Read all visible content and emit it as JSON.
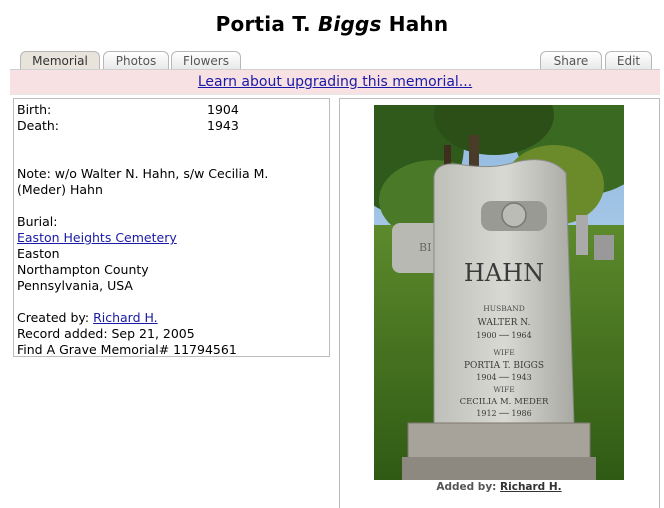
{
  "title": {
    "first": "Portia T. ",
    "maiden": "Biggs",
    "last": " Hahn"
  },
  "tabs": {
    "memorial": "Memorial",
    "photos": "Photos",
    "flowers": "Flowers",
    "share": "Share",
    "edit": "Edit"
  },
  "upgrade_link": "Learn about upgrading this memorial...",
  "info": {
    "birth_label": "Birth:",
    "birth_value": "1904",
    "death_label": "Death:",
    "death_value": "1943",
    "note_line1": "Note: w/o Walter N. Hahn, s/w Cecilia M.",
    "note_line2": "(Meder) Hahn",
    "burial_label": "Burial:",
    "cemetery": "Easton Heights Cemetery",
    "city": "Easton",
    "county": "Northampton County",
    "state": "Pennsylvania, USA",
    "created_by_label": "Created by: ",
    "created_by": "Richard H.",
    "record_added": "Record added: Sep 21, 2005",
    "memorial_number": "Find A Grave Memorial# 11794561"
  },
  "photo": {
    "stone_name": "HAHN",
    "husband_label": "HUSBAND",
    "husband_name": "WALTER   N.",
    "husband_dates": "1900 ── 1964",
    "wife1_label": "WIFE",
    "wife1_name": "PORTIA T. BIGGS",
    "wife1_dates": "1904 ── 1943",
    "wife2_label": "WIFE",
    "wife2_name": "CECILIA M. MEDER",
    "wife2_dates": "1912 ── 1986",
    "back_stone_text": "BI",
    "caption_label": "Added by: ",
    "caption_user": "Richard H."
  }
}
